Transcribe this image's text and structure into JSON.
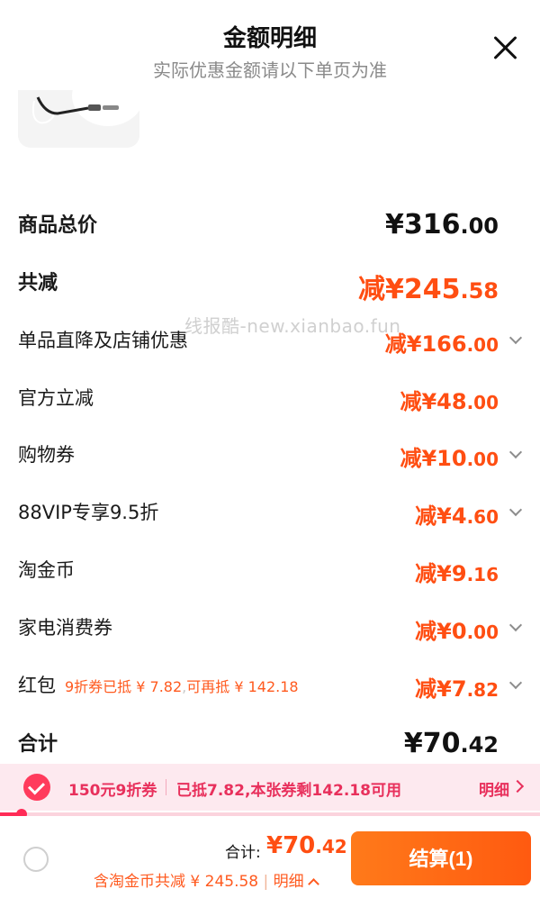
{
  "header": {
    "title": "金额明细",
    "subtitle": "实际优惠金额请以下单页为准"
  },
  "watermark": "线报酷-new.xianbao.fun",
  "rows": {
    "total_price": {
      "label": "商品总价",
      "prefix": "¥",
      "int": "316",
      "dec": ".00"
    },
    "total_discount": {
      "label": "共减",
      "prefix": "减¥",
      "int": "245",
      "dec": ".58"
    },
    "shop_discount": {
      "label": "单品直降及店铺优惠",
      "prefix": "减¥",
      "int": "166",
      "dec": ".00"
    },
    "official_discount": {
      "label": "官方立减",
      "prefix": "减¥",
      "int": "48",
      "dec": ".00"
    },
    "shopping_coupon": {
      "label": "购物券",
      "prefix": "减¥",
      "int": "10",
      "dec": ".00"
    },
    "vip_discount": {
      "label": "88VIP专享9.5折",
      "prefix": "减¥",
      "int": "4",
      "dec": ".60"
    },
    "taojinbi": {
      "label": "淘金币",
      "prefix": "减¥",
      "int": "9",
      "dec": ".16"
    },
    "appliance_coupon": {
      "label": "家电消费券",
      "prefix": "减¥",
      "int": "0",
      "dec": ".00"
    },
    "hongbao": {
      "label": "红包",
      "note_a": "9折券已抵 ¥ 7.82",
      "note_sep": ",",
      "note_b": "可再抵 ¥ 142.18",
      "prefix": "减¥",
      "int": "7",
      "dec": ".82"
    },
    "subtotal": {
      "label": "合计",
      "prefix": "¥",
      "int": "70",
      "dec": ".42"
    }
  },
  "coupon_bar": {
    "name": "150元9折券",
    "desc": "已抵7.82,本张券剩142.18可用",
    "detail": "明细",
    "progress": 0.04,
    "accent": "#ff2b56"
  },
  "bottom": {
    "total_label": "合计:",
    "total_prefix": "¥",
    "total_int": "70",
    "total_dec": ".42",
    "saving_a": "含淘金币共减 ¥ 245.58",
    "saving_sep": "|",
    "saving_b": "明细",
    "settle": "结算(1)",
    "brand_color": "#ff5a10"
  }
}
